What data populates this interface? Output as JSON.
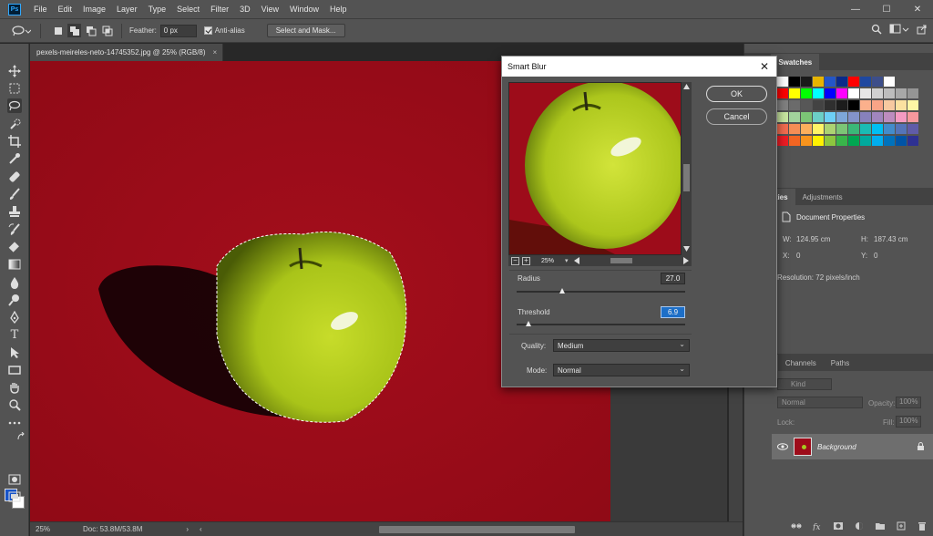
{
  "app": {
    "logo": "Ps",
    "menu": [
      "File",
      "Edit",
      "Image",
      "Layer",
      "Type",
      "Select",
      "Filter",
      "3D",
      "View",
      "Window",
      "Help"
    ],
    "window_controls": {
      "minimize": "—",
      "maximize": "☐",
      "close": "✕"
    }
  },
  "options_bar": {
    "feather_label": "Feather:",
    "feather_value": "0 px",
    "antialias_label": "Anti-alias",
    "select_mask_label": "Select and Mask..."
  },
  "document": {
    "tab_title": "pexels-meireles-neto-14745352.jpg @ 25% (RGB/8)",
    "tab_close": "×",
    "zoom": "25%",
    "doc_info": "Doc: 53.8M/53.8M",
    "canvas_color": "#9d0c1a",
    "apple_color": "#b5d126"
  },
  "panels": {
    "top_tabs": [
      "olor",
      "Swatches"
    ],
    "props_tabs": [
      "Properties",
      "Adjustments"
    ],
    "properties_title": "Document Properties",
    "W_label": "W:",
    "W_value": "124.95 cm",
    "H_label": "H:",
    "H_value": "187.43 cm",
    "X_label": "X:",
    "X_value": "0",
    "Y_label": "Y:",
    "Y_value": "0",
    "resolution": "Resolution: 72 pixels/inch",
    "layers_tabs": [
      "ayers",
      "Channels",
      "Paths"
    ],
    "kind_label": "Kind",
    "blend_mode": "Normal",
    "opacity_label": "Opacity:",
    "opacity_value": "100%",
    "lock_label": "Lock:",
    "fill_label": "Fill:",
    "fill_value": "100%",
    "layer_name": "Background"
  },
  "dialog": {
    "title": "Smart Blur",
    "close": "✕",
    "ok_label": "OK",
    "cancel_label": "Cancel",
    "preview_zoom": "25%",
    "radius_label": "Radius",
    "radius_value": "27.0",
    "radius_level": 0.27,
    "threshold_label": "Threshold",
    "threshold_value": "6.9",
    "threshold_level": 0.07,
    "quality_label": "Quality:",
    "quality_value": "Medium",
    "mode_label": "Mode:",
    "mode_value": "Normal"
  },
  "swatches": [
    [
      "#ffffff",
      "#000000",
      "#1a1a1a",
      "#e6b400",
      "#2456c8",
      "#0b2a8a",
      "#ff0000",
      "#1f48a0",
      "#3d4e8a",
      "#ffffff"
    ],
    [
      "#ff0000",
      "#ffff00",
      "#00ff00",
      "#00ffff",
      "#0000ff",
      "#ff00ff",
      "#ffffff",
      "#e6e6e6",
      "#d0d0d0",
      "#bdbdbd",
      "#a8a8a8",
      "#959595"
    ],
    [
      "#808080",
      "#6b6b6b",
      "#575757",
      "#434343",
      "#2f2f2f",
      "#1c1c1c",
      "#000000",
      "#fbb08c",
      "#f9a487",
      "#f7c9a0",
      "#fbe1a0",
      "#fff6a5"
    ],
    [
      "#c8e6a0",
      "#a2d39c",
      "#7cc576",
      "#6ccfc7",
      "#6dcff6",
      "#7da7d9",
      "#8393ca",
      "#8781bd",
      "#a186be",
      "#bd8cbf",
      "#f49ac2",
      "#f6989d"
    ],
    [
      "#f26c4f",
      "#f68e55",
      "#fbaf5c",
      "#fff467",
      "#acd372",
      "#7cc576",
      "#3bb878",
      "#1abbb4",
      "#00bff3",
      "#438ccb",
      "#5574b9",
      "#605ca8"
    ],
    [
      "#ed1c24",
      "#f26522",
      "#f7941d",
      "#fff200",
      "#8dc63f",
      "#39b54a",
      "#00a651",
      "#00a99d",
      "#00aeef",
      "#0072bc",
      "#0054a6",
      "#2e3192"
    ]
  ]
}
